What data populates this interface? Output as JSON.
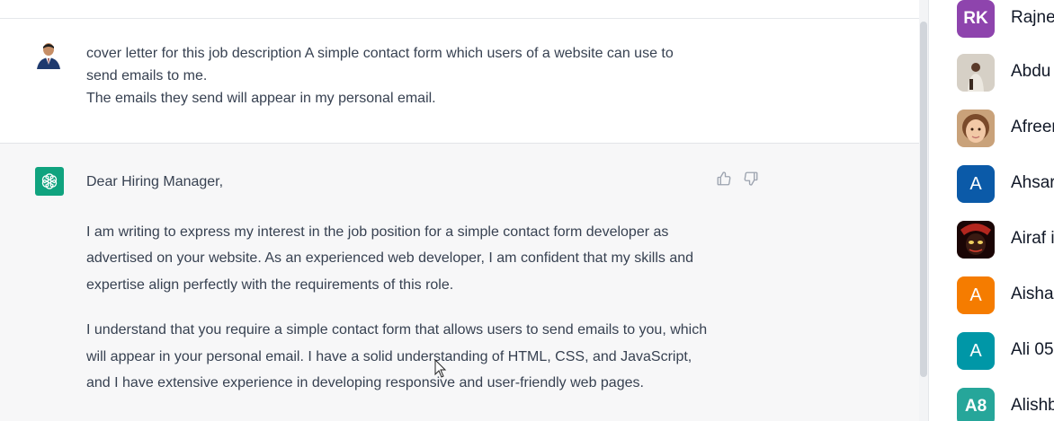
{
  "conversation": {
    "user_message": {
      "lines": [
        "cover letter for this job description A simple contact form which users of a website can use to send emails to me.",
        "The emails they send will appear in my personal email."
      ]
    },
    "assistant_message": {
      "greeting": "Dear Hiring Manager,",
      "paragraphs": [
        "I am writing to express my interest in the job position for a simple contact form developer as advertised on your website. As an experienced web developer, I am confident that my skills and expertise align perfectly with the requirements of this role.",
        "I understand that you require a simple contact form that allows users to send emails to you, which will appear in your personal email. I have a solid understanding of HTML, CSS, and JavaScript, and I have extensive experience in developing responsive and user-friendly web pages."
      ],
      "feedback": {
        "like_icon": "thumbs-up-icon",
        "dislike_icon": "thumbs-down-icon"
      }
    }
  },
  "contacts": [
    {
      "initials": "RK",
      "name": "Rajne",
      "color": "#8e44ad",
      "type": "initials"
    },
    {
      "initials": "",
      "name": "Abdu",
      "color": "#c9c2b8",
      "type": "photo"
    },
    {
      "initials": "",
      "name": "Afreer",
      "color": "#e8b48a",
      "type": "photo"
    },
    {
      "initials": "A",
      "name": "Ahsar",
      "color": "#0b5aa8",
      "type": "initials"
    },
    {
      "initials": "",
      "name": "Airaf i",
      "color": "#2a0a0a",
      "type": "photo"
    },
    {
      "initials": "A",
      "name": "Aisha",
      "color": "#f57c00",
      "type": "initials"
    },
    {
      "initials": "A",
      "name": "Ali 05",
      "color": "#0097a7",
      "type": "initials"
    },
    {
      "initials": "A8",
      "name": "Alishb",
      "color": "#26a69a",
      "type": "initials"
    }
  ]
}
